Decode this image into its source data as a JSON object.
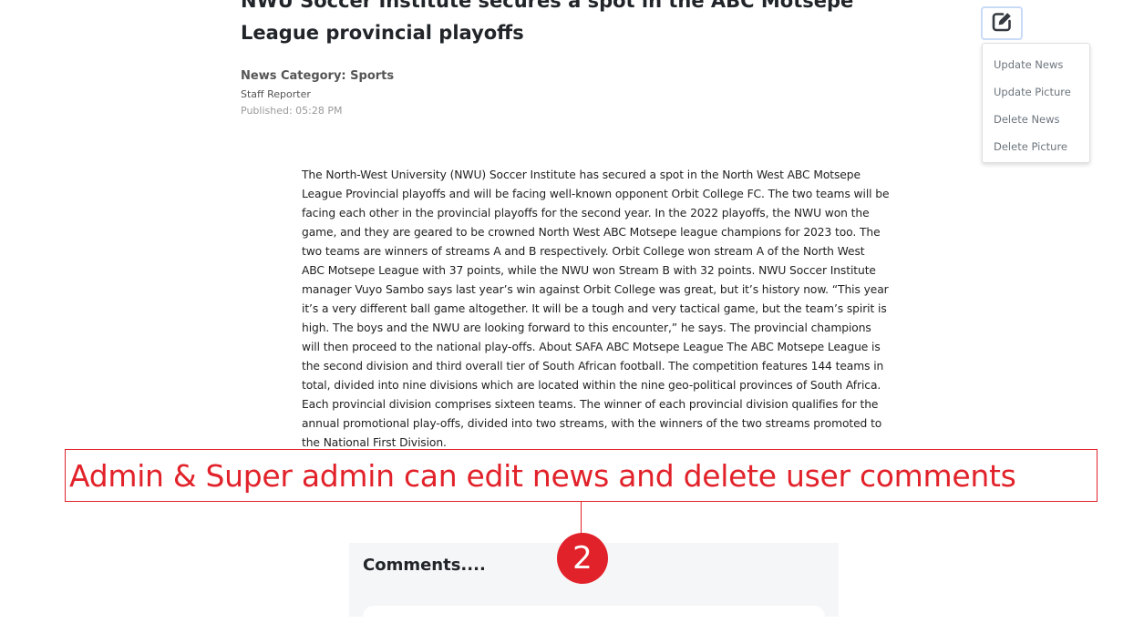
{
  "article": {
    "title": "NWU Soccer Institute secures a spot in the ABC Motsepe League provincial playoffs",
    "category": "News Category: Sports",
    "reporter": "Staff Reporter",
    "published": "Published: 05:28 PM",
    "body": "The North-West University (NWU) Soccer Institute has secured a spot in the North West ABC Motsepe League Provincial playoffs and will be facing well-known opponent Orbit College FC. The two teams will be facing each other in the provincial playoffs for the second year. In the 2022 playoffs, the NWU won the game, and they are geared to be crowned North West ABC Motsepe league champions for 2023 too. The two teams are winners of streams A and B respectively. Orbit College won stream A of the North West ABC Motsepe League with 37 points, while the NWU won Stream B with 32 points. NWU Soccer Institute manager Vuyo Sambo says last year’s win against Orbit College was great, but it’s history now. “This year it’s a very different ball game altogether. It will be a tough and very tactical game, but the team’s spirit is high. The boys and the NWU are looking forward to this encounter,” he says. The provincial champions will then proceed to the national play-offs. About SAFA ABC Motsepe League The ABC Motsepe League is the second division and third overall tier of South African football. The competition features 144 teams in total, divided into nine divisions which are located within the nine geo-political provinces of South Africa. Each provincial division comprises sixteen teams. The winner of each provincial division qualifies for the annual promotional play-offs, divided into two streams, with the winners of the two streams promoted to the National First Division."
  },
  "edit_menu": {
    "icon": "edit-icon",
    "items": [
      {
        "label": "Update News"
      },
      {
        "label": "Update Picture"
      },
      {
        "label": "Delete News"
      },
      {
        "label": "Delete Picture"
      }
    ]
  },
  "annotation": {
    "text": "Admin & Super admin can edit news and delete user comments",
    "badge": "2",
    "color": "#e2222a"
  },
  "comments": {
    "title": "Comments...."
  }
}
